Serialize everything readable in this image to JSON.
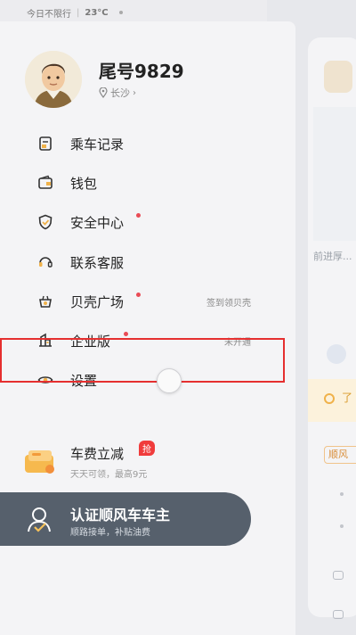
{
  "status_bar": {
    "left_text": "今日不限行",
    "temperature": "23°C"
  },
  "profile": {
    "username": "尾号9829",
    "location": "长沙"
  },
  "menu": {
    "ride_records": "乘车记录",
    "wallet": "钱包",
    "safety_center": "安全中心",
    "customer_service": "联系客服",
    "shell_plaza": "贝壳广场",
    "shell_plaza_side": "签到领贝壳",
    "enterprise": "企业版",
    "enterprise_side": "未开通",
    "settings": "设置"
  },
  "promo": {
    "title": "车费立减",
    "badge": "抢",
    "subtitle": "天天可领，最高9元"
  },
  "driver_banner": {
    "title": "认证顺风车车主",
    "subtitle": "顺路接单，补贴油费"
  },
  "background_app": {
    "visible_text": "前进厚...",
    "yellow_text": "了",
    "tag_text": "顺风"
  },
  "colors": {
    "highlight": "#e52f2f",
    "red_dot": "#e94b55",
    "banner": "#56606c",
    "accent": "#f0b24a"
  }
}
